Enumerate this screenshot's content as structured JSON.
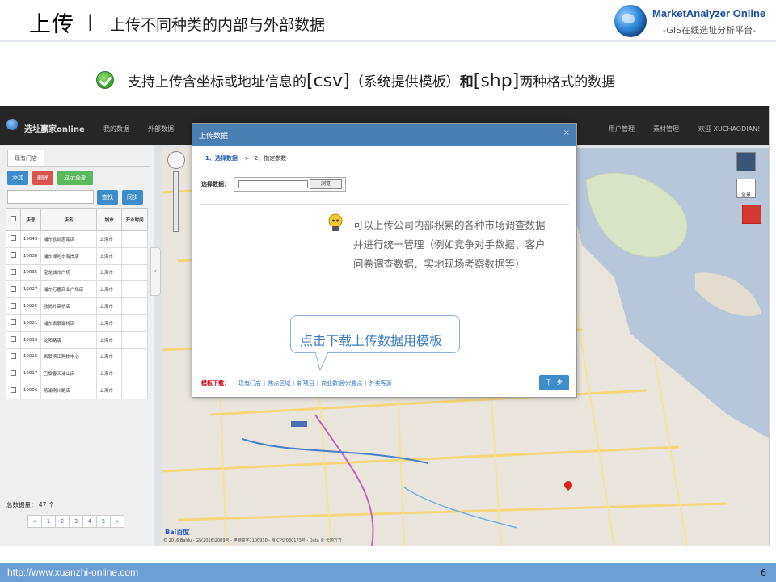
{
  "slide": {
    "title": "上传",
    "separator": "|",
    "subtitle": "上传不同种类的内部与外部数据",
    "bullet": {
      "part1": "支持上传含坐标或地址信息的",
      "csv": "[csv]",
      "part2": "（系统提供模板）",
      "and": "和",
      "shp": "[shp]",
      "part3": "两种格式的数据"
    },
    "callout": "点击下载上传数据用模板",
    "footer_url": "http://www.xuanzhi-online.com",
    "page_number": "6"
  },
  "brand": {
    "name": "MarketAnalyzer Online",
    "tagline": "-GIS在线选址分析平台-"
  },
  "app": {
    "logo": "选址赢家online",
    "nav_left": [
      "我的数据",
      "外部数据"
    ],
    "nav_right": [
      "用户管理",
      "素材管理",
      "欢迎 XUCHAODIAN!"
    ],
    "panel_tab": "现有门店",
    "buttons": {
      "add": "添加",
      "delete": "删除",
      "show_all": "显示全部",
      "search": "查找",
      "sync": "同步"
    },
    "table": {
      "headers": [
        "",
        "店号",
        "店名",
        "城市",
        "开业时间"
      ],
      "rows": [
        [
          "10043",
          "浦东欧尚惠南店",
          "上海市"
        ],
        [
          "10038",
          "浦东绿地东海岸店",
          "上海市"
        ],
        [
          "10035",
          "宝龙城市广场",
          "上海市"
        ],
        [
          "10027",
          "浦东万嘉商业广场店",
          "上海市"
        ],
        [
          "10025",
          "欧尚外高桥店",
          "上海市"
        ],
        [
          "10021",
          "浦东百联御桥店",
          "上海市"
        ],
        [
          "10019",
          "龙阳路店",
          "上海市"
        ],
        [
          "10015",
          "百联滨江购物中心",
          "上海市"
        ],
        [
          "10017",
          "巴黎春天浦山店",
          "上海市"
        ],
        [
          "10006",
          "杨浦刚州路店",
          "上海市"
        ]
      ]
    },
    "total": "总数据量： 47 个",
    "pager": [
      "«",
      "1",
      "2",
      "3",
      "4",
      "5",
      "»"
    ],
    "map": {
      "copyright": "© 2016 Baidu - GS(2016)2089号 - 甲测资字1100930 - 京ICP证030173号 - Data © 长地万方",
      "logo": "Bai百度",
      "corner_label": "全景"
    }
  },
  "modal": {
    "title": "上传数据",
    "close": "×",
    "step1": "1、选择数据",
    "arrow": "->",
    "step2": "2、指定参数",
    "file_label": "选择数据：",
    "browse": "浏览",
    "info": "可以上传公司内部积累的各种市场调查数据并进行统一管理（例如竞争对手数据、客户问卷调查数据、实地现场考察数据等）",
    "template_label": "模板下载：",
    "template_links": [
      "现有门店",
      "焦点区域",
      "新项目",
      "商业数据/兴趣点",
      "外卖客源"
    ],
    "next": "下一步"
  },
  "colors": {
    "header_blue": "#4a7fb3",
    "footer_blue": "#6b9fd6",
    "nav_dark": "#262626",
    "callout_text": "#3a7dc0",
    "template_red": "#d0021b"
  }
}
